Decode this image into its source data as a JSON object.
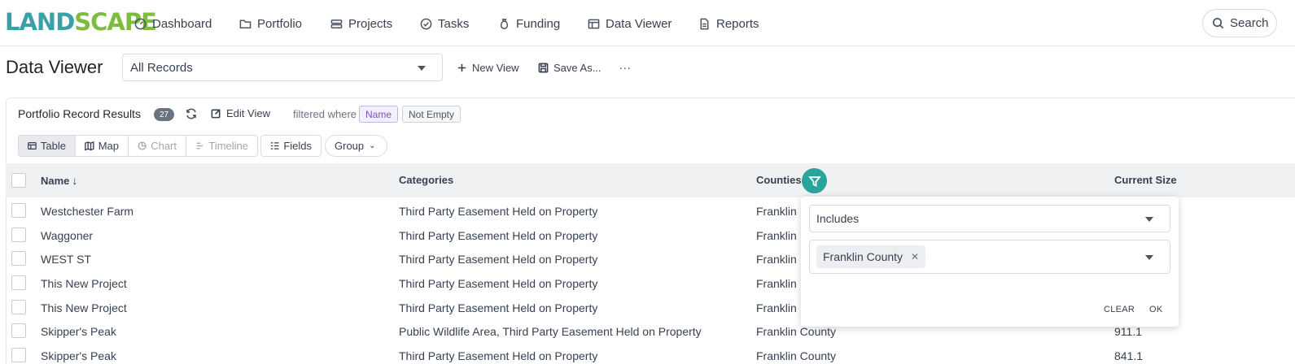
{
  "nav": {
    "logo_part1": "LAND",
    "logo_part2": "SCAPE",
    "items": [
      {
        "label": "Dashboard",
        "icon": "gauge-icon"
      },
      {
        "label": "Portfolio",
        "icon": "folder-icon"
      },
      {
        "label": "Projects",
        "icon": "projects-icon"
      },
      {
        "label": "Tasks",
        "icon": "check-circle-icon"
      },
      {
        "label": "Funding",
        "icon": "money-bag-icon"
      },
      {
        "label": "Data Viewer",
        "icon": "table-icon"
      },
      {
        "label": "Reports",
        "icon": "document-icon"
      }
    ],
    "search_label": "Search"
  },
  "header": {
    "title": "Data Viewer",
    "view_select_value": "All Records",
    "new_view_label": "New View",
    "save_as_label": "Save As...",
    "more_label": "..."
  },
  "results": {
    "title": "Portfolio Record Results",
    "count": "27",
    "edit_view_label": "Edit View",
    "filtered_text": "filtered where",
    "filter_field": "Name",
    "filter_condition": "Not Empty"
  },
  "toggles": {
    "table": "Table",
    "map": "Map",
    "chart": "Chart",
    "timeline": "Timeline",
    "fields": "Fields",
    "group": "Group"
  },
  "table": {
    "columns": {
      "name": "Name",
      "categories": "Categories",
      "counties": "Counties",
      "current_size": "Current Size"
    },
    "sort_indicator": "↓",
    "rows": [
      {
        "name": "Westchester Farm",
        "categories": "Third Party Easement Held on Property",
        "counties": "Franklin",
        "size": ""
      },
      {
        "name": "Waggoner",
        "categories": "Third Party Easement Held on Property",
        "counties": "Franklin",
        "size": ""
      },
      {
        "name": "WEST ST",
        "categories": "Third Party Easement Held on Property",
        "counties": "Franklin",
        "size": ""
      },
      {
        "name": "This New Project",
        "categories": "Third Party Easement Held on Property",
        "counties": "Franklin",
        "size": ""
      },
      {
        "name": "This New Project",
        "categories": "Third Party Easement Held on Property",
        "counties": "Franklin",
        "size": ""
      },
      {
        "name": "Skipper's Peak",
        "categories": "Public Wildlife Area, Third Party Easement Held on Property",
        "counties": "Franklin County",
        "size": "911.1"
      },
      {
        "name": "Skipper's Peak",
        "categories": "Third Party Easement Held on Property",
        "counties": "Franklin County",
        "size": "841.1"
      }
    ]
  },
  "filter_popover": {
    "operator": "Includes",
    "selected_tag": "Franklin County",
    "clear_label": "CLEAR",
    "ok_label": "OK"
  },
  "colors": {
    "accent_teal": "#2aa39a",
    "logo_teal": "#3aa0a8",
    "logo_green": "#7cbd3f",
    "chip_purple": "#7c4dcc"
  }
}
